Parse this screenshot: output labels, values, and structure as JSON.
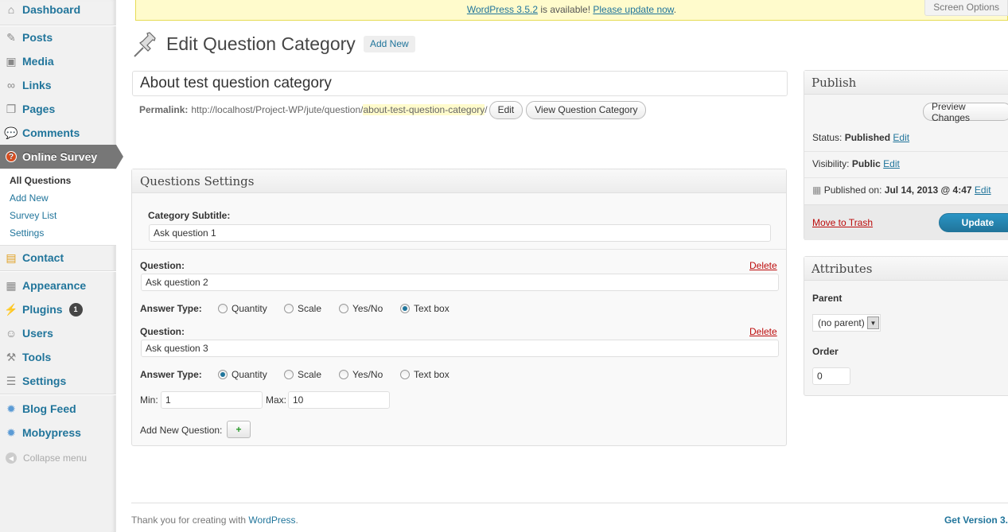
{
  "sidebar": {
    "items": [
      {
        "key": "dashboard",
        "label": "Dashboard",
        "icon": "dashboard-icon"
      },
      {
        "key": "posts",
        "label": "Posts",
        "icon": "pushpin-icon"
      },
      {
        "key": "media",
        "label": "Media",
        "icon": "media-icon"
      },
      {
        "key": "links",
        "label": "Links",
        "icon": "link-icon"
      },
      {
        "key": "pages",
        "label": "Pages",
        "icon": "pages-icon"
      },
      {
        "key": "comments",
        "label": "Comments",
        "icon": "comment-icon"
      },
      {
        "key": "survey",
        "label": "Online Survey",
        "icon": "survey-icon"
      },
      {
        "key": "contact",
        "label": "Contact",
        "icon": "contact-icon"
      },
      {
        "key": "appearance",
        "label": "Appearance",
        "icon": "appearance-icon"
      },
      {
        "key": "plugins",
        "label": "Plugins",
        "icon": "plugin-icon",
        "badge": "1"
      },
      {
        "key": "users",
        "label": "Users",
        "icon": "users-icon"
      },
      {
        "key": "tools",
        "label": "Tools",
        "icon": "tools-icon"
      },
      {
        "key": "settings",
        "label": "Settings",
        "icon": "settings-icon"
      },
      {
        "key": "blogfeed",
        "label": "Blog Feed",
        "icon": "gear-icon"
      },
      {
        "key": "mobypress",
        "label": "Mobypress",
        "icon": "gear-icon"
      }
    ],
    "submenu": [
      "All Questions",
      "Add New",
      "Survey List",
      "Settings"
    ],
    "collapse_label": "Collapse menu"
  },
  "notice": {
    "version_link": "WordPress 3.5.2",
    "middle": " is available! ",
    "update_link": "Please update now",
    "end": "."
  },
  "screen_options": "Screen Options",
  "header": {
    "title": "Edit Question Category",
    "add_new": "Add New"
  },
  "post_title": "About test question category",
  "permalink": {
    "label": "Permalink:",
    "base": "http://localhost/Project-WP/jute/question/",
    "slug": "about-test-question-category",
    "trailing": "/",
    "edit_button": "Edit",
    "view_button": "View Question Category"
  },
  "questions_box": {
    "title": "Questions Settings",
    "subtitle_label": "Category Subtitle:",
    "subtitle_value": "Ask question 1",
    "question_label": "Question:",
    "delete_label": "Delete",
    "answer_type_label": "Answer Type:",
    "answer_types": [
      "Quantity",
      "Scale",
      "Yes/No",
      "Text box"
    ],
    "questions": [
      {
        "value": "Ask question 2",
        "selected": "Text box"
      },
      {
        "value": "Ask question 3",
        "selected": "Quantity"
      }
    ],
    "min_label": "Min:",
    "min_value": "1",
    "max_label": "Max:",
    "max_value": "10",
    "add_new_label": "Add New Question:",
    "add_button": "+"
  },
  "publish": {
    "title": "Publish",
    "preview_button": "Preview Changes",
    "status_label": "Status:",
    "status_value": "Published",
    "visibility_label": "Visibility:",
    "visibility_value": "Public",
    "published_label": "Published on:",
    "published_value": "Jul 14, 2013 @ 4:47",
    "edit_link": "Edit",
    "trash_link": "Move to Trash",
    "update_button": "Update"
  },
  "attributes": {
    "title": "Attributes",
    "parent_label": "Parent",
    "parent_value": "(no parent)",
    "order_label": "Order",
    "order_value": "0"
  },
  "footer": {
    "thanks": "Thank you for creating with ",
    "wp_link": "WordPress",
    "dot": ".",
    "get_version": "Get Version 3."
  },
  "colors": {
    "link": "#21759b",
    "danger": "#bc0b0b",
    "active_menu": "#777777",
    "notice_bg": "#fffbcc"
  }
}
